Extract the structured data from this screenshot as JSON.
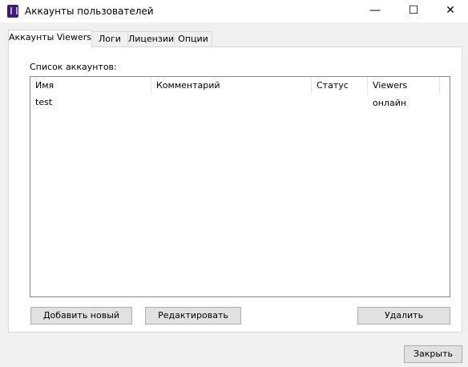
{
  "window": {
    "title": "Аккаунты пользователей",
    "controls": {
      "minimize": "—",
      "maximize": "☐",
      "close": "✕"
    }
  },
  "tabs": [
    {
      "label": "Аккаунты Viewers",
      "active": true
    },
    {
      "label": "Логи",
      "active": false
    },
    {
      "label": "Лицензии",
      "active": false
    },
    {
      "label": "Опции",
      "active": false
    }
  ],
  "accounts": {
    "list_label": "Список аккаунтов:",
    "columns": [
      "Имя",
      "Комментарий",
      "Статус",
      "Viewers онлайн"
    ],
    "rows": [
      {
        "name": "test",
        "comment": "",
        "status": "",
        "viewers_online": ""
      }
    ]
  },
  "buttons": {
    "add": "Добавить новый",
    "edit": "Редактировать",
    "delete": "Удалить",
    "close": "Закрыть"
  }
}
